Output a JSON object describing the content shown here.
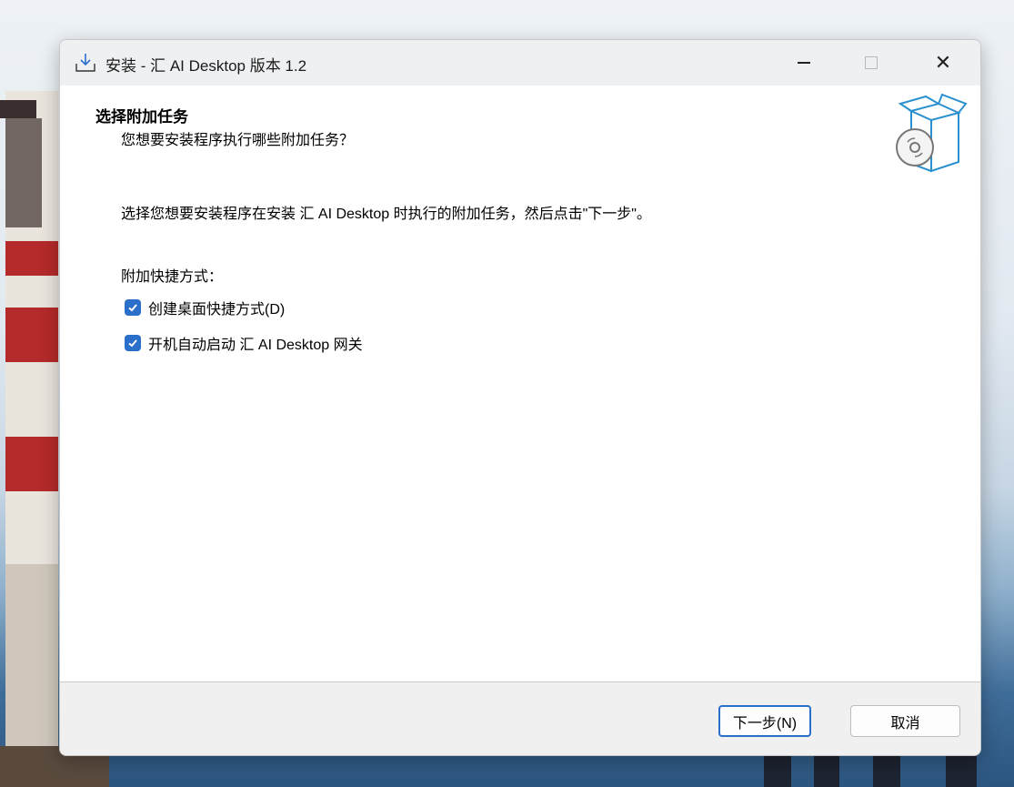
{
  "window": {
    "title": "安装 - 汇 AI Desktop 版本 1.2",
    "title_icon": "install-download-icon",
    "controls": [
      "minimize",
      "maximize",
      "close"
    ]
  },
  "page": {
    "heading": "选择附加任务",
    "subheading": "您想要安装程序执行哪些附加任务？",
    "description": "选择您想要安装程序在安装 汇 AI Desktop 时执行的附加任务，然后点击\"下一步\"。",
    "group_label": "附加快捷方式：",
    "header_icon": "software-box-disc-icon"
  },
  "tasks": [
    {
      "label": "创建桌面快捷方式(D)",
      "checked": true
    },
    {
      "label": "开机自动启动 汇 AI Desktop 网关",
      "checked": true
    }
  ],
  "buttons": {
    "next": "下一步(N)",
    "cancel": "取消"
  },
  "colors": {
    "accent": "#2a6fc9",
    "titlebar": "#eef0f2",
    "footer": "#f0f0f0"
  }
}
